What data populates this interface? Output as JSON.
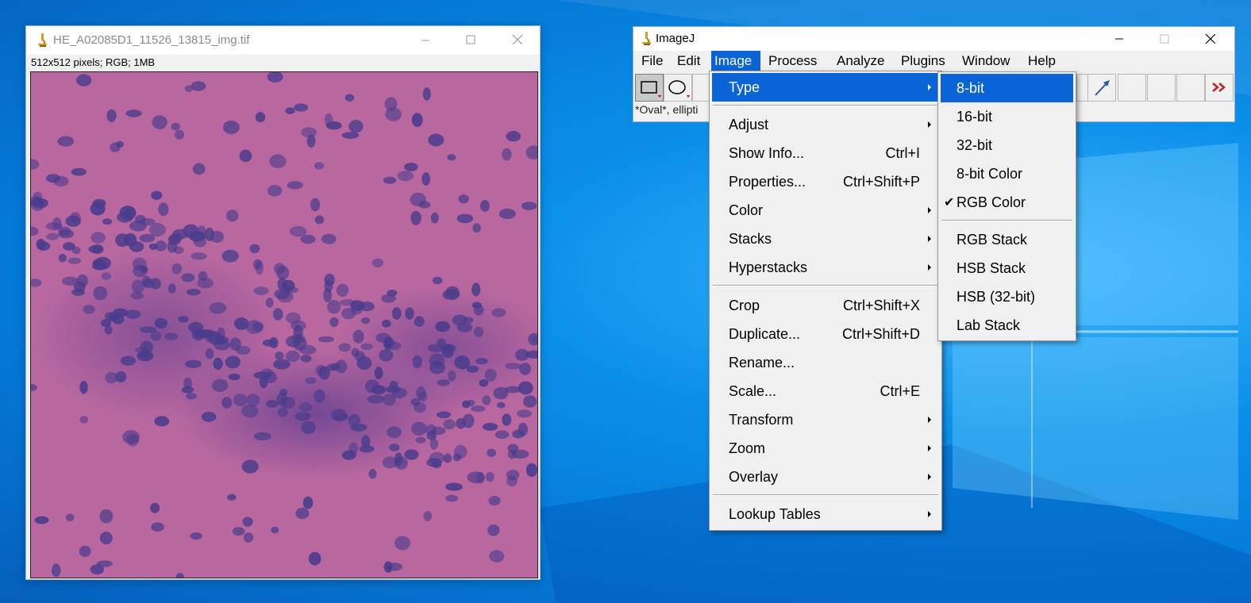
{
  "image_window": {
    "title": "HE_A02085D1_11526_13815_img.tif",
    "info": "512x512 pixels; RGB; 1MB"
  },
  "imagej_window": {
    "title": "ImageJ",
    "menubar": [
      "File",
      "Edit",
      "Image",
      "Process",
      "Analyze",
      "Plugins",
      "Window",
      "Help"
    ],
    "active_menu": "Image",
    "status": "*Oval*, ellipti"
  },
  "image_menu": {
    "items": [
      {
        "label": "Type",
        "shortcut": "",
        "submenu": true
      },
      {
        "label": "Adjust",
        "shortcut": "",
        "submenu": true
      },
      {
        "label": "Show Info...",
        "shortcut": "Ctrl+I",
        "submenu": false
      },
      {
        "label": "Properties...",
        "shortcut": "Ctrl+Shift+P",
        "submenu": false
      },
      {
        "label": "Color",
        "shortcut": "",
        "submenu": true
      },
      {
        "label": "Stacks",
        "shortcut": "",
        "submenu": true
      },
      {
        "label": "Hyperstacks",
        "shortcut": "",
        "submenu": true
      },
      {
        "label": "Crop",
        "shortcut": "Ctrl+Shift+X",
        "submenu": false
      },
      {
        "label": "Duplicate...",
        "shortcut": "Ctrl+Shift+D",
        "submenu": false
      },
      {
        "label": "Rename...",
        "shortcut": "",
        "submenu": false
      },
      {
        "label": "Scale...",
        "shortcut": "Ctrl+E",
        "submenu": false
      },
      {
        "label": "Transform",
        "shortcut": "",
        "submenu": true
      },
      {
        "label": "Zoom",
        "shortcut": "",
        "submenu": true
      },
      {
        "label": "Overlay",
        "shortcut": "",
        "submenu": true
      },
      {
        "label": "Lookup Tables",
        "shortcut": "",
        "submenu": true
      }
    ]
  },
  "type_submenu": {
    "items": [
      {
        "label": "8-bit",
        "checked": false
      },
      {
        "label": "16-bit",
        "checked": false
      },
      {
        "label": "32-bit",
        "checked": false
      },
      {
        "label": "8-bit Color",
        "checked": false
      },
      {
        "label": "RGB Color",
        "checked": true
      },
      {
        "label": "RGB Stack",
        "checked": false
      },
      {
        "label": "HSB Stack",
        "checked": false
      },
      {
        "label": "HSB (32-bit)",
        "checked": false
      },
      {
        "label": "Lab Stack",
        "checked": false
      }
    ],
    "check_glyph": "✔"
  },
  "colors": {
    "highlight": "#0a64d6",
    "desktop": "#0578d6",
    "tissue_pink": "#b9689f",
    "nuclei": "#4a3c8c"
  },
  "icons": [
    "imagej-microscope-icon",
    "minimize-icon",
    "maximize-icon",
    "close-icon",
    "rectangle-tool-icon",
    "oval-tool-icon",
    "arrow-tool-icon",
    "more-tools-icon"
  ]
}
